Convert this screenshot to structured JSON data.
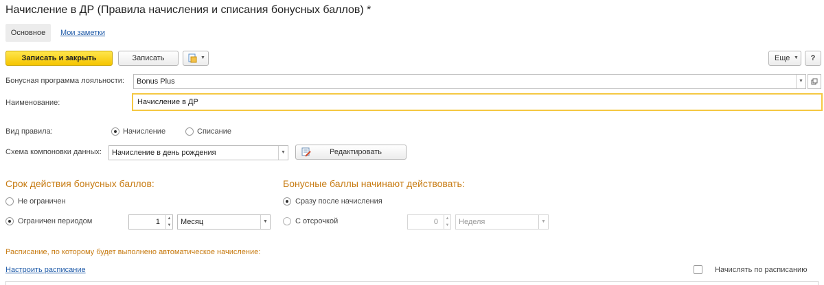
{
  "window": {
    "title": "Начисление в ДР (Правила начисления и списания бонусных баллов) *"
  },
  "tabs": {
    "main": "Основное",
    "notes": "Мои заметки"
  },
  "toolbar": {
    "save_close": "Записать и закрыть",
    "save": "Записать",
    "more": "Еще",
    "help": "?"
  },
  "form": {
    "program_label": "Бонусная программа лояльности:",
    "program_value": "Bonus Plus",
    "name_label": "Наименование:",
    "name_value": "Начисление в ДР",
    "rule_type_label": "Вид правила:",
    "rule_type_options": [
      "Начисление",
      "Списание"
    ],
    "rule_type_selected": "Начисление",
    "schema_label": "Схема компоновки данных:",
    "schema_value": "Начисление в день рождения",
    "edit_button": "Редактировать"
  },
  "validity": {
    "title": "Срок действия бонусных баллов:",
    "unlimited": "Не ограничен",
    "limited": "Ограничен периодом",
    "period_count": "1",
    "period_unit": "Месяц"
  },
  "start": {
    "title": "Бонусные баллы начинают действовать:",
    "immediately": "Сразу после начисления",
    "delayed": "С отсрочкой",
    "delay_count": "0",
    "delay_unit": "Неделя"
  },
  "schedule": {
    "note": "Расписание, по которому будет выполнено автоматическое начисление:",
    "setup_link": "Настроить расписание",
    "by_schedule_label": "Начислять по расписанию"
  },
  "icons": {
    "dropdown": "chevron-down-icon",
    "open": "open-form-icon",
    "doc_menu": "document-menu-icon",
    "edit": "edit-schema-icon"
  }
}
